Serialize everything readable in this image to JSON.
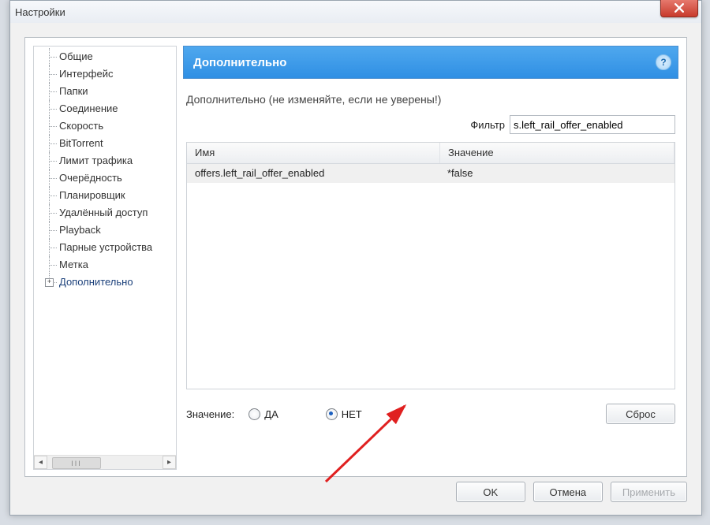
{
  "window": {
    "title": "Настройки",
    "close_label": "x"
  },
  "tree": {
    "items": [
      {
        "id": "general",
        "label": "Общие"
      },
      {
        "id": "interface",
        "label": "Интерфейс"
      },
      {
        "id": "folders",
        "label": "Папки"
      },
      {
        "id": "connection",
        "label": "Соединение"
      },
      {
        "id": "speed",
        "label": "Скорость"
      },
      {
        "id": "bt",
        "label": "BitTorrent"
      },
      {
        "id": "traffic",
        "label": "Лимит трафика"
      },
      {
        "id": "queue",
        "label": "Очерёдность"
      },
      {
        "id": "scheduler",
        "label": "Планировщик"
      },
      {
        "id": "remote",
        "label": "Удалённый доступ"
      },
      {
        "id": "playback",
        "label": "Playback"
      },
      {
        "id": "paired",
        "label": "Парные устройства"
      },
      {
        "id": "labels",
        "label": "Метка"
      },
      {
        "id": "advanced",
        "label": "Дополнительно",
        "expandable": true,
        "selected": true
      }
    ]
  },
  "content": {
    "header": "Дополнительно",
    "help_symbol": "?",
    "warning": "Дополнительно (не изменяйте, если не уверены!)",
    "filter_label": "Фильтр",
    "filter_value": "s.left_rail_offer_enabled",
    "columns": {
      "name": "Имя",
      "value": "Значение"
    },
    "rows": [
      {
        "name": "offers.left_rail_offer_enabled",
        "value": "*false"
      }
    ],
    "value_label": "Значение:",
    "radio_yes": "ДА",
    "radio_no": "НЕТ",
    "radio_selected": "no",
    "reset_label": "Сброс"
  },
  "buttons": {
    "ok": "OK",
    "cancel": "Отмена",
    "apply": "Применить"
  }
}
